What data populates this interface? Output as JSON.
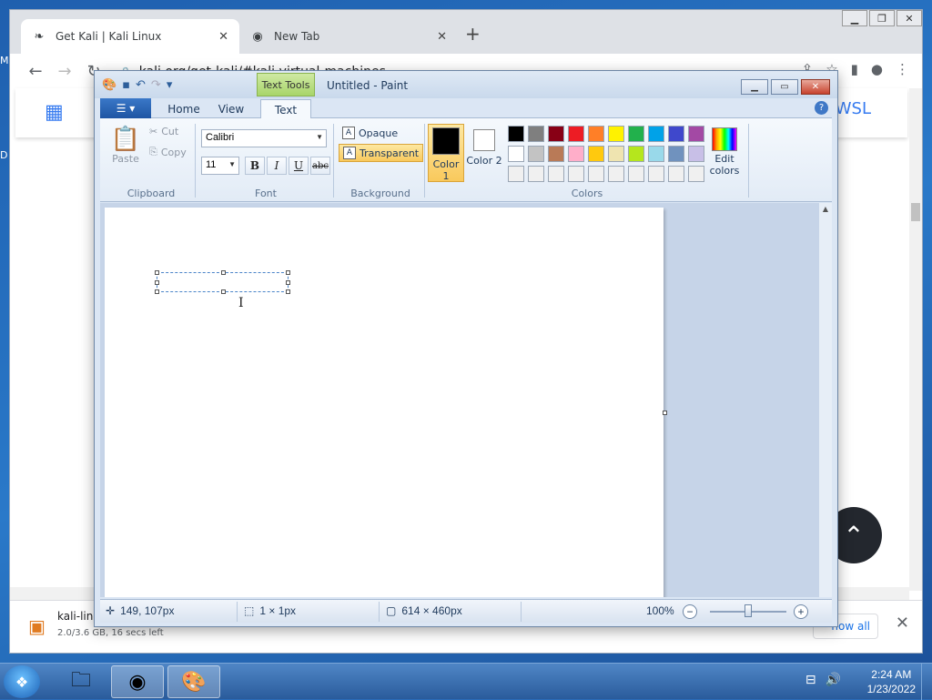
{
  "desktop": {
    "label_m": "M",
    "label_d": "D"
  },
  "chrome": {
    "tabs": [
      {
        "title": "Get Kali | Kali Linux",
        "icon": "kali-dragon-icon"
      },
      {
        "title": "New Tab",
        "icon": "chrome-icon"
      }
    ],
    "url": "kali.org/get-kali/#kali-virtual-machines",
    "site": {
      "nav_link": "WSL"
    },
    "downloads": {
      "file_name": "kali-lin",
      "status": "2.0/3.6 GB, 16 secs left",
      "show_all": "how all"
    }
  },
  "paint": {
    "title": "Untitled - Paint",
    "context_tab": "Text Tools",
    "tabs": {
      "home": "Home",
      "view": "View",
      "text": "Text"
    },
    "clipboard": {
      "paste": "Paste",
      "cut": "Cut",
      "copy": "Copy",
      "label": "Clipboard"
    },
    "font": {
      "name": "Calibri",
      "size": "11",
      "bold": "B",
      "italic": "I",
      "underline": "U",
      "strike": "abc",
      "label": "Font"
    },
    "background": {
      "opaque": "Opaque",
      "transparent": "Transparent",
      "label": "Background"
    },
    "colors": {
      "color1_label": "Color 1",
      "color2_label": "Color 2",
      "color1": "#000000",
      "color2": "#ffffff",
      "edit_colors": "Edit colors",
      "label": "Colors",
      "palette": [
        "#000000",
        "#7f7f7f",
        "#880015",
        "#ed1c24",
        "#ff7f27",
        "#fff200",
        "#22b14c",
        "#00a2e8",
        "#3f48cc",
        "#a349a4",
        "#ffffff",
        "#c3c3c3",
        "#b97a57",
        "#ffaec9",
        "#ffc90e",
        "#efe4b0",
        "#b5e61d",
        "#99d9ea",
        "#7092be",
        "#c8bfe7",
        "#f0f0f0",
        "#f0f0f0",
        "#f0f0f0",
        "#f0f0f0",
        "#f0f0f0",
        "#f0f0f0",
        "#f0f0f0",
        "#f0f0f0",
        "#f0f0f0",
        "#f0f0f0"
      ]
    },
    "status": {
      "cursor_pos": "149, 107px",
      "selection_size": "1 × 1px",
      "image_size": "614 × 460px",
      "zoom": "100%"
    }
  },
  "taskbar": {
    "time": "2:24 AM",
    "date": "1/23/2022"
  }
}
